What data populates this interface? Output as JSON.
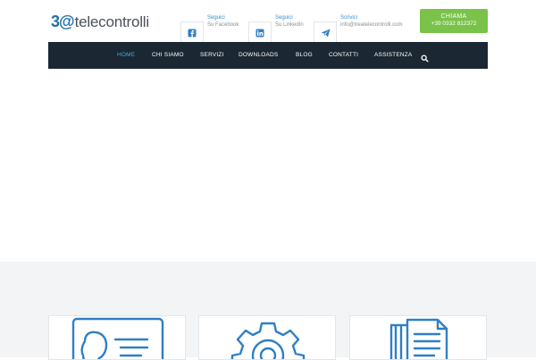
{
  "logo": {
    "mark": "3@",
    "text": "telecontrolli"
  },
  "contacts": [
    {
      "label": "Seguici",
      "value": "Su Facebook",
      "icon": "facebook-icon"
    },
    {
      "label": "Seguici",
      "value": "Su LinkedIn",
      "icon": "linkedin-icon"
    },
    {
      "label": "Scrivici",
      "value": "info@treatelecontrolli.com",
      "icon": "paper-plane-icon"
    }
  ],
  "call": {
    "label": "CHIAMA",
    "number": "+39 0332 812372"
  },
  "nav": {
    "items": [
      "HOME",
      "CHI SIAMO",
      "SERVIZI",
      "DOWNLOADS",
      "BLOG",
      "CONTATTI",
      "ASSISTENZA"
    ],
    "active": "HOME",
    "search_icon": "search-icon"
  },
  "colors": {
    "brand_blue": "#1f6fa8",
    "nav_bg": "#1b2732",
    "nav_active": "#4aa4e0",
    "call_green": "#7ac24a",
    "section_bg": "#f2f4f5",
    "icon_blue": "#2f7fc4"
  },
  "cards": [
    {
      "icon": "id-card-icon"
    },
    {
      "icon": "gear-icon"
    },
    {
      "icon": "documents-icon"
    }
  ]
}
